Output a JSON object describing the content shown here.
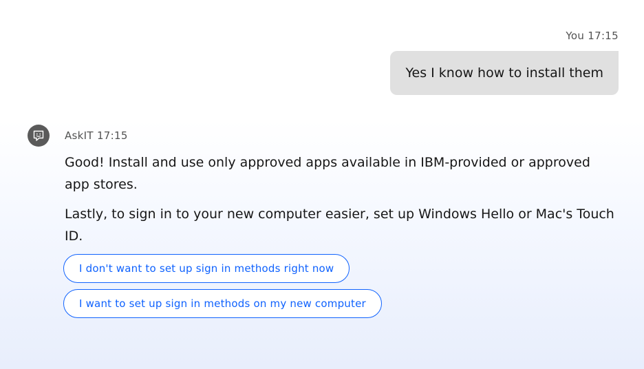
{
  "conversation": {
    "user_message": {
      "sender": "You",
      "time": "17:15",
      "text": "Yes I know how to install them"
    },
    "bot_message": {
      "sender": "AskIT",
      "time": "17:15",
      "avatar_icon": "chat-bot-icon",
      "paragraphs": [
        "Good! Install and use only approved apps available in IBM-provided or approved app stores.",
        "Lastly, to sign in to your new computer easier, set up Windows Hello or Mac's Touch ID."
      ],
      "options": [
        "I don't want to set up sign in methods right now",
        "I want to set up sign in methods on my new computer"
      ]
    }
  },
  "colors": {
    "accent": "#0f62fe",
    "user_bubble": "#e0e0e0",
    "avatar": "#5a5a5a"
  }
}
